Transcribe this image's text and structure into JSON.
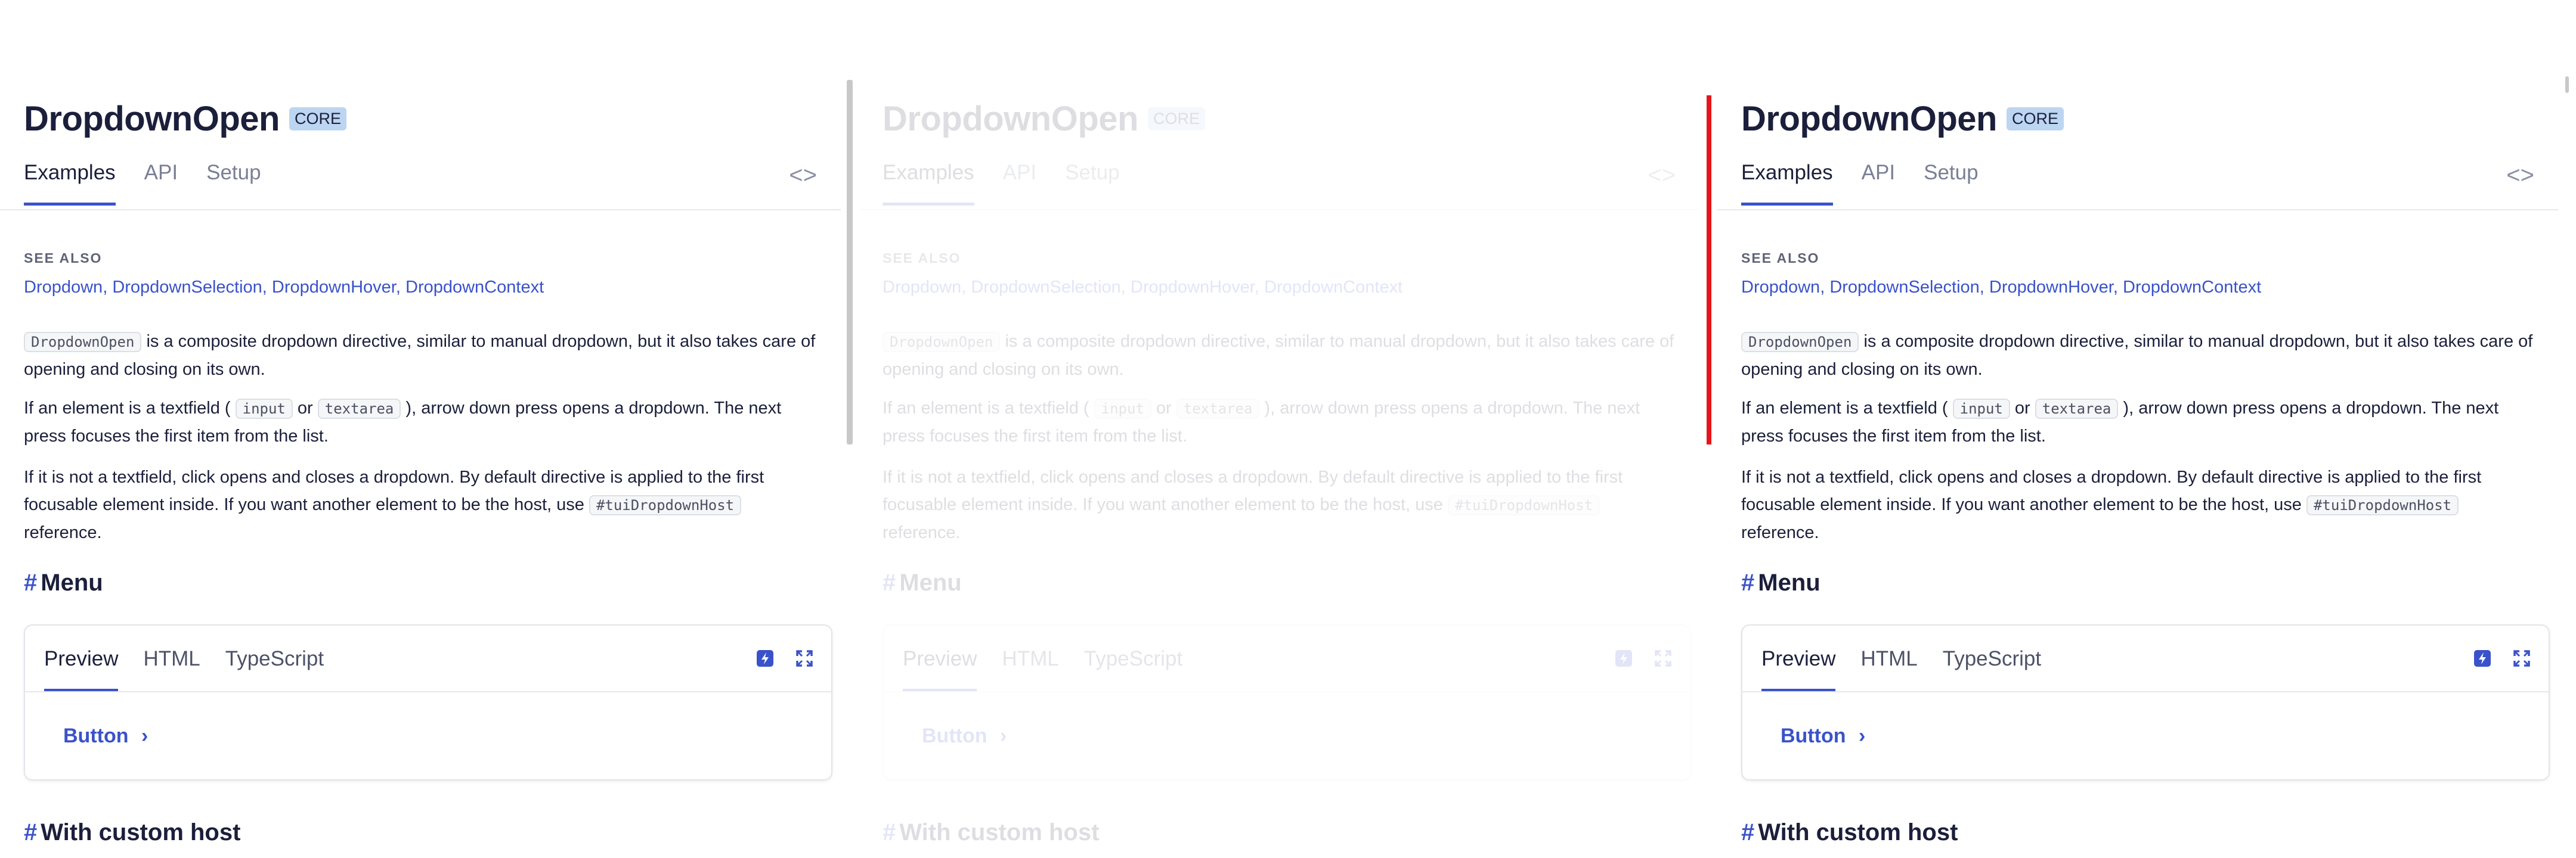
{
  "page": {
    "title": "DropdownOpen",
    "badge": "CORE",
    "tabs": [
      "Examples",
      "API",
      "Setup"
    ],
    "code_toggle": "<>",
    "see_also": {
      "label": "SEE ALSO",
      "links": [
        "Dropdown",
        "DropdownSelection",
        "DropdownHover",
        "DropdownContext"
      ],
      "separator": ","
    },
    "para1": {
      "code": "DropdownOpen",
      "text": " is a composite dropdown directive, similar to manual dropdown, but it also takes care of opening and closing on its own."
    },
    "para2": {
      "pre": "If an element is a textfield ( ",
      "code1": "input",
      "mid": " or ",
      "code2": "textarea",
      "post": " ), arrow down press opens a dropdown. The next press focuses the first item from the list."
    },
    "para3": {
      "pre": "If it is not a textfield, click opens and closes a dropdown. By default directive is applied to the first focusable element inside. If you want another element to be the host, use ",
      "code": "#tuiDropdownHost",
      "post": " reference."
    },
    "section_menu": {
      "hash": "#",
      "title": "Menu"
    },
    "demo": {
      "tabs": [
        "Preview",
        "HTML",
        "TypeScript"
      ],
      "button_label": "Button",
      "button_chevron": "›",
      "icons": [
        "lightning-icon",
        "expand-icon"
      ]
    },
    "section_custom": {
      "hash": "#",
      "title": "With custom host"
    },
    "colors": {
      "accent": "#3a52c9",
      "badge_bg": "#bcd5f1",
      "focus_bar": "#e8141c"
    }
  }
}
